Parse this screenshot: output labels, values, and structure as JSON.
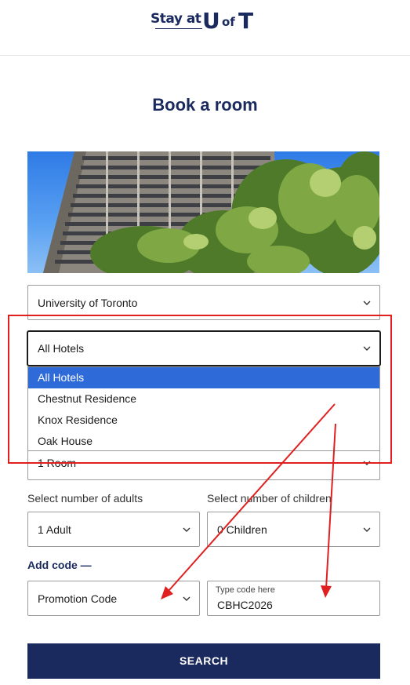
{
  "header": {
    "logo_stay": "Stay at",
    "logo_u": "U",
    "logo_of": "of",
    "logo_t": "T"
  },
  "page_title": "Book a room",
  "university_select": {
    "value": "University of Toronto"
  },
  "hotel_select": {
    "value": "All Hotels",
    "options": [
      "All Hotels",
      "Chestnut Residence",
      "Knox Residence",
      "Oak House"
    ],
    "highlighted_index": 0
  },
  "rooms_select": {
    "value": "1 Room"
  },
  "adults": {
    "label": "Select number of adults",
    "value": "1 Adult"
  },
  "children": {
    "label": "Select number of children",
    "value": "0 Children"
  },
  "add_code": {
    "label": "Add code",
    "symbol": "—"
  },
  "promo_select": {
    "value": "Promotion Code"
  },
  "code_field": {
    "placeholder": "Type code here",
    "value": "CBHC2026"
  },
  "search_button": {
    "label": "SEARCH"
  },
  "colors": {
    "brand_navy": "#1a2a5e",
    "option_highlight": "#2e6bd9",
    "annotation_red": "#e02020"
  }
}
